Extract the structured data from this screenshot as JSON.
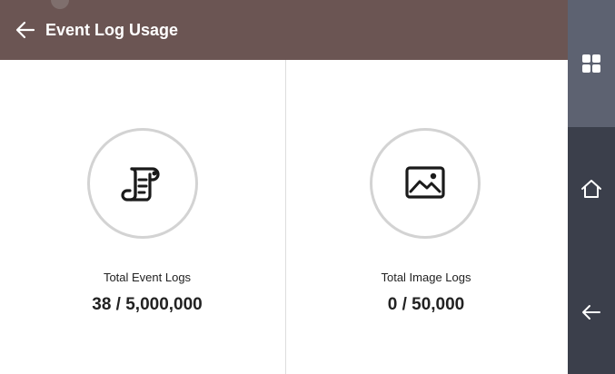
{
  "header": {
    "title": "Event Log Usage",
    "back_icon": "arrow-left-icon"
  },
  "event_logs": {
    "icon": "scroll-document-icon",
    "label": "Total Event Logs",
    "value": "38 / 5,000,000"
  },
  "image_logs": {
    "icon": "image-icon",
    "label": "Total Image Logs",
    "value": "0 / 50,000"
  },
  "sidenav": {
    "items": [
      {
        "icon": "grid-menu-icon"
      },
      {
        "icon": "home-icon"
      },
      {
        "icon": "back-arrow-icon"
      }
    ]
  },
  "colors": {
    "header": "#6b5553",
    "sidenav": "#3b3f4b",
    "sidenav_active": "#5d6271",
    "circle_border": "#d3d3d3"
  }
}
